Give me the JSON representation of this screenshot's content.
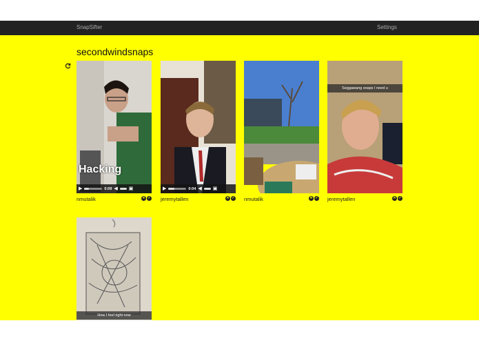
{
  "nav": {
    "brand": "SnapSifter",
    "settings": "Settings"
  },
  "page": {
    "title": "secondwindsnaps"
  },
  "refresh_icon": "refresh-icon",
  "cards": [
    {
      "user": "nmutalik",
      "overlay": "Hacking",
      "time": "0:09",
      "progress": 0.25
    },
    {
      "user": "jeremytallen",
      "time": "0:04",
      "progress": 0.35
    },
    {
      "user": "nmutalik"
    },
    {
      "user": "jeremytallen",
      "caption": "Seggawang snaps I need u"
    },
    {
      "caption": "How I feel right now"
    }
  ],
  "colors": {
    "background": "#ffff00",
    "navbar": "#222222"
  }
}
